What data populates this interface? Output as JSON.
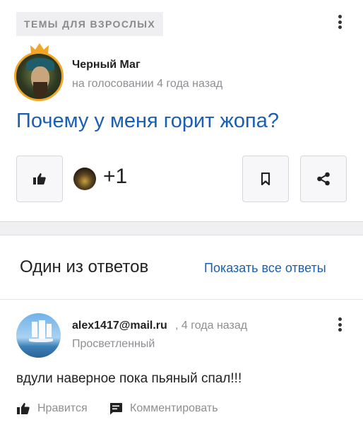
{
  "question": {
    "category": "ТЕМЫ ДЛЯ ВЗРОСЛЫХ",
    "author": "Черный Маг",
    "meta": "на голосовании 4 года назад",
    "title": "Почему у меня горит жопа?",
    "like_count": "+1"
  },
  "answers_section": {
    "title": "Один из ответов",
    "show_all_label": "Показать все ответы"
  },
  "answer": {
    "author": "alex1417@mail.ru",
    "time": ", 4 года назад",
    "rank": "Просветленный",
    "text": "вдули наверное пока пьяный спал!!!",
    "like_label": "Нравится",
    "comment_label": "Комментировать"
  },
  "icons": {
    "crown": "crown-icon",
    "like": "thumbs-up-icon",
    "bookmark": "bookmark-icon",
    "share": "share-icon",
    "comment": "comment-icon",
    "more": "more-vertical-icon"
  },
  "colors": {
    "link": "#1a5fb4",
    "muted": "#8e8e93",
    "crown": "#f2a626"
  }
}
